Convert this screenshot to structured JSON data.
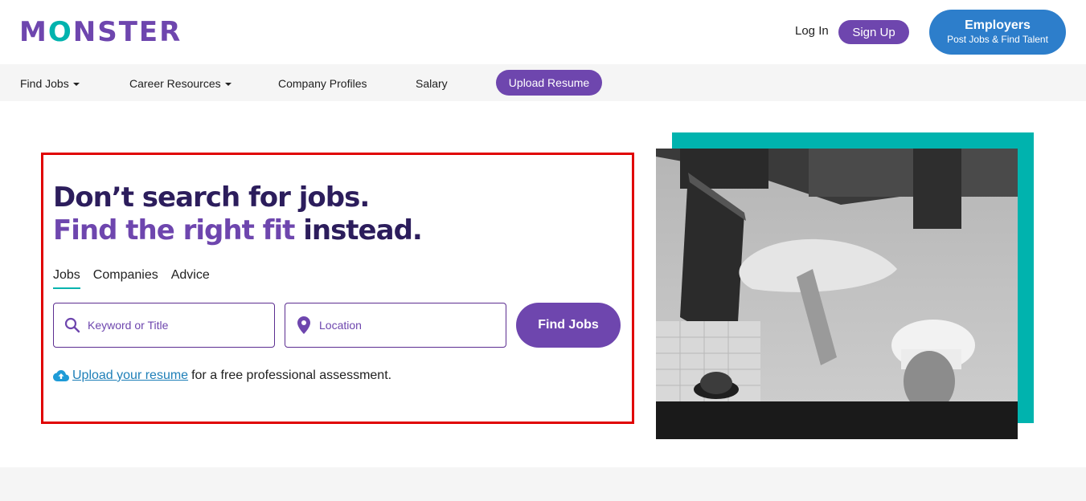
{
  "header": {
    "logo_text_1": "M",
    "logo_text_2": "O",
    "logo_text_3": "NSTER",
    "login_label": "Log In",
    "signup_label": "Sign Up",
    "employers_title": "Employers",
    "employers_subtitle": "Post Jobs & Find Talent"
  },
  "nav": {
    "items": [
      {
        "label": "Find Jobs",
        "dropdown": true
      },
      {
        "label": "Career Resources",
        "dropdown": true
      },
      {
        "label": "Company Profiles",
        "dropdown": false
      },
      {
        "label": "Salary",
        "dropdown": false
      }
    ],
    "upload_resume_label": "Upload Resume"
  },
  "hero": {
    "headline_line1": "Don’t search for jobs.",
    "headline_line2_accent": "Find the right fit",
    "headline_line2_rest": " instead.",
    "tabs": [
      {
        "label": "Jobs",
        "active": true
      },
      {
        "label": "Companies",
        "active": false
      },
      {
        "label": "Advice",
        "active": false
      }
    ],
    "keyword_placeholder": "Keyword or Title",
    "location_placeholder": "Location",
    "find_jobs_label": "Find Jobs",
    "upload_link_text": "Upload your resume",
    "upload_suffix_text": "for a free professional assessment."
  },
  "colors": {
    "brand_purple": "#6e46ae",
    "brand_teal": "#00b3ae",
    "employers_blue": "#2d7ecb",
    "headline_dark": "#2c1d5c",
    "highlight_border": "#e00000"
  },
  "icons": [
    "search-icon",
    "location-pin-icon",
    "cloud-upload-icon",
    "caret-down-icon"
  ]
}
